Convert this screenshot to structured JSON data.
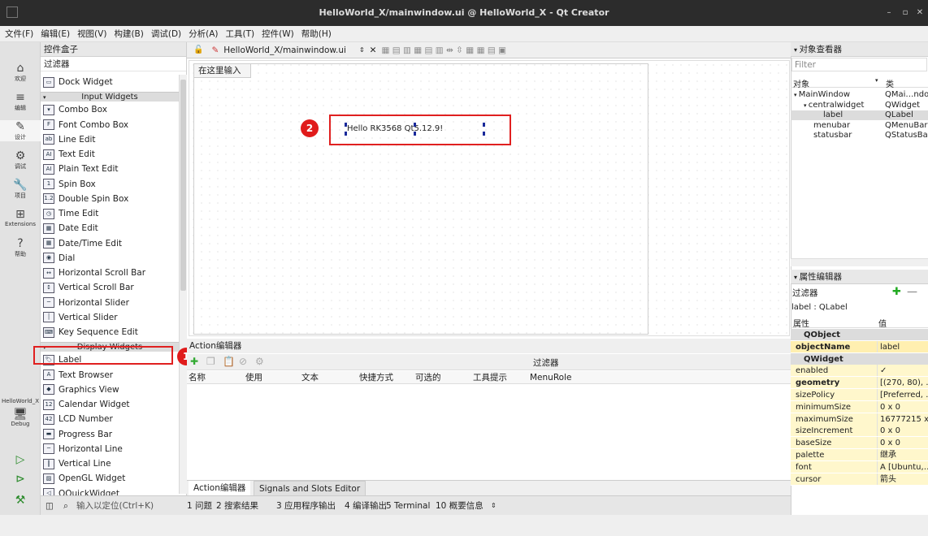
{
  "window": {
    "title": "HelloWorld_X/mainwindow.ui @ HelloWorld_X - Qt Creator"
  },
  "menu": [
    "文件(F)",
    "编辑(E)",
    "视图(V)",
    "构建(B)",
    "调试(D)",
    "分析(A)",
    "工具(T)",
    "控件(W)",
    "帮助(H)"
  ],
  "modes": [
    {
      "label": "欢迎",
      "icon": "⌂"
    },
    {
      "label": "编辑",
      "icon": "≡"
    },
    {
      "label": "设计",
      "icon": "✎"
    },
    {
      "label": "调试",
      "icon": "⚙"
    },
    {
      "label": "项目",
      "icon": "🔧"
    },
    {
      "label": "Extensions",
      "icon": "⊞"
    },
    {
      "label": "帮助",
      "icon": "?"
    }
  ],
  "kit": {
    "project": "HelloWorld_X",
    "config": "Debug"
  },
  "widgetbox": {
    "title": "控件盒子",
    "filter": "过滤器",
    "items": [
      {
        "label": "Dock Widget",
        "icon": "▭"
      },
      {
        "category": "Input Widgets"
      },
      {
        "label": "Combo Box",
        "icon": "▾"
      },
      {
        "label": "Font Combo Box",
        "icon": "F"
      },
      {
        "label": "Line Edit",
        "icon": "ab"
      },
      {
        "label": "Text Edit",
        "icon": "AI"
      },
      {
        "label": "Plain Text Edit",
        "icon": "AI"
      },
      {
        "label": "Spin Box",
        "icon": "1"
      },
      {
        "label": "Double Spin Box",
        "icon": "1.2"
      },
      {
        "label": "Time Edit",
        "icon": "◷"
      },
      {
        "label": "Date Edit",
        "icon": "▦"
      },
      {
        "label": "Date/Time Edit",
        "icon": "▦"
      },
      {
        "label": "Dial",
        "icon": "◉"
      },
      {
        "label": "Horizontal Scroll Bar",
        "icon": "↔"
      },
      {
        "label": "Vertical Scroll Bar",
        "icon": "↕"
      },
      {
        "label": "Horizontal Slider",
        "icon": "─"
      },
      {
        "label": "Vertical Slider",
        "icon": "│"
      },
      {
        "label": "Key Sequence Edit",
        "icon": "⌨"
      },
      {
        "category": "Display Widgets"
      },
      {
        "label": "Label",
        "icon": "🏷"
      },
      {
        "label": "Text Browser",
        "icon": "A"
      },
      {
        "label": "Graphics View",
        "icon": "◆"
      },
      {
        "label": "Calendar Widget",
        "icon": "12"
      },
      {
        "label": "LCD Number",
        "icon": "42"
      },
      {
        "label": "Progress Bar",
        "icon": "▬"
      },
      {
        "label": "Horizontal Line",
        "icon": "─"
      },
      {
        "label": "Vertical Line",
        "icon": "║"
      },
      {
        "label": "OpenGL Widget",
        "icon": "▨"
      },
      {
        "label": "QQuickWidget",
        "icon": "◁"
      }
    ]
  },
  "editor": {
    "tab_file": "HelloWorld_X/mainwindow.ui",
    "menu_placeholder": "在这里输入",
    "label_text": "Hello RK3568 Qt5.12.9!"
  },
  "badges": [
    "1",
    "2"
  ],
  "action_editor": {
    "title": "Action编辑器",
    "filter": "过滤器",
    "columns": [
      "名称",
      "使用",
      "文本",
      "快捷方式",
      "可选的",
      "工具提示",
      "MenuRole"
    ],
    "tabs": [
      "Action编辑器",
      "Signals and Slots Editor"
    ]
  },
  "statusbar": {
    "locate_placeholder": "输入以定位(Ctrl+K)",
    "items": [
      "1 问题",
      "2 搜索结果",
      "3 应用程序输出",
      "4 编译输出",
      "5 Terminal",
      "10 概要信息"
    ]
  },
  "object_inspector": {
    "title": "对象查看器",
    "filter": "Filter",
    "col_object": "对象",
    "col_class": "类",
    "rows": [
      {
        "name": "MainWindow",
        "cls": "QMai…ndow"
      },
      {
        "name": "centralwidget",
        "cls": "QWidget"
      },
      {
        "name": "label",
        "cls": "QLabel"
      },
      {
        "name": "menubar",
        "cls": "QMenuBar"
      },
      {
        "name": "statusbar",
        "cls": "QStatusBar"
      }
    ]
  },
  "property_editor": {
    "title": "属性编辑器",
    "filter": "过滤器",
    "object": "label : QLabel",
    "col_prop": "属性",
    "col_val": "值",
    "rows": [
      {
        "name": "QObject",
        "value": "",
        "group": true
      },
      {
        "name": "objectName",
        "value": "label"
      },
      {
        "name": "QWidget",
        "value": "",
        "group": true
      },
      {
        "name": "enabled",
        "value": "✓"
      },
      {
        "name": "geometry",
        "value": "[(270, 80), …"
      },
      {
        "name": "sizePolicy",
        "value": "[Preferred, …"
      },
      {
        "name": "minimumSize",
        "value": "0 x 0"
      },
      {
        "name": "maximumSize",
        "value": "16777215 x…"
      },
      {
        "name": "sizeIncrement",
        "value": "0 x 0"
      },
      {
        "name": "baseSize",
        "value": "0 x 0"
      },
      {
        "name": "palette",
        "value": "继承"
      },
      {
        "name": "font",
        "value": "A [Ubuntu,…"
      },
      {
        "name": "cursor",
        "value": "箭头"
      }
    ]
  },
  "colors": {
    "highlight_red": "#e01b1b",
    "titlebar": "#2c2c2c"
  }
}
